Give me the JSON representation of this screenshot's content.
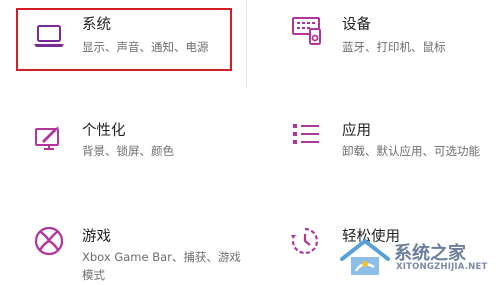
{
  "settings": {
    "tiles": [
      {
        "title": "系统",
        "desc": "显示、声音、通知、电源",
        "icon": "laptop-icon"
      },
      {
        "title": "设备",
        "desc": "蓝牙、打印机、鼠标",
        "icon": "devices-icon"
      },
      {
        "title": "个性化",
        "desc": "背景、锁屏、颜色",
        "icon": "personalization-icon"
      },
      {
        "title": "应用",
        "desc": "卸载、默认应用、可选功能",
        "icon": "apps-icon"
      },
      {
        "title": "游戏",
        "desc": "Xbox Game Bar、捕获、游戏模式",
        "icon": "xbox-icon"
      },
      {
        "title": "轻松使用",
        "desc": "",
        "icon": "ease-of-access-icon"
      }
    ]
  },
  "watermark": {
    "name": "系统之家",
    "url": "XITONGZHIJIA.NET"
  },
  "colors": {
    "icon": "#b3359c",
    "highlight": "#d21f25",
    "system_icon": "#7a2a9b"
  }
}
